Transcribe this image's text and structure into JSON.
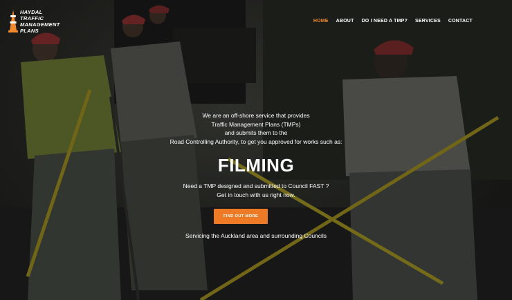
{
  "brand": {
    "logo_lines": [
      "HAYDAL",
      "TRAFFIC",
      "MANAGEMENT",
      "PLANS"
    ],
    "accent_color": "#f08a2c"
  },
  "nav": {
    "items": [
      {
        "label": "HOME",
        "active": true
      },
      {
        "label": "ABOUT",
        "active": false
      },
      {
        "label": "DO I NEED A TMP?",
        "active": false
      },
      {
        "label": "SERVICES",
        "active": false
      },
      {
        "label": "CONTACT",
        "active": false
      }
    ]
  },
  "hero": {
    "intro_lines": [
      "We are an off-shore service that provides",
      "Traffic Management Plans (TMPs)",
      "and submits them to the",
      "Road Controlling Authority, to get you approved for works such as:"
    ],
    "headline": "FILMING",
    "sub_lines": [
      "Need a TMP designed and submitted to Council FAST ?",
      "Get in touch with us right now."
    ],
    "cta_label": "FIND OUT MORE",
    "cta_color": "#ef7a26",
    "footer_text": "Servicing the Auckland area and surrounding Councils"
  }
}
